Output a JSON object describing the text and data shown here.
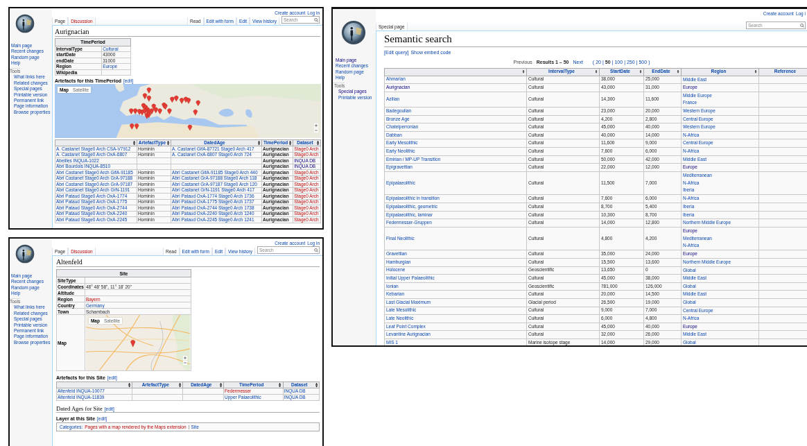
{
  "windows": [
    {
      "kind": "article",
      "title": "Aurignacian",
      "personal": [
        {
          "text": "Create account",
          "kind": "link"
        },
        {
          "text": "Log in",
          "kind": "link"
        }
      ],
      "left_tabs": [
        {
          "label": "Page",
          "selected": true,
          "kind": "plain"
        },
        {
          "label": "Discussion",
          "selected": false,
          "kind": "new"
        }
      ],
      "right_tabs": [
        {
          "label": "Read",
          "selected": true,
          "kind": "plain"
        },
        {
          "label": "Edit with form",
          "selected": false,
          "kind": "link"
        },
        {
          "label": "Edit",
          "selected": false,
          "kind": "link"
        },
        {
          "label": "View history",
          "selected": false,
          "kind": "link"
        }
      ],
      "search": {
        "placeholder": "Search"
      },
      "nav": [
        {
          "text": "Main page",
          "kind": "link"
        },
        {
          "text": "Recent changes",
          "kind": "link"
        },
        {
          "text": "Random page",
          "kind": "link"
        },
        {
          "text": "Help",
          "kind": "link"
        }
      ],
      "tools_heading": "Tools",
      "tools": [
        {
          "text": "What links here",
          "kind": "link"
        },
        {
          "text": "Related changes",
          "kind": "link"
        },
        {
          "text": "Special pages",
          "kind": "link"
        },
        {
          "text": "Printable version",
          "kind": "link"
        },
        {
          "text": "Permanent link",
          "kind": "link"
        },
        {
          "text": "Page information",
          "kind": "link"
        },
        {
          "text": "Browse properties",
          "kind": "link"
        }
      ],
      "infobox": {
        "heading": "TimePeriod",
        "rows": [
          {
            "label": "IntervalType",
            "value": {
              "text": "Cultural",
              "kind": "link"
            }
          },
          {
            "label": "startDate",
            "value": {
              "text": "43000",
              "kind": "plain"
            }
          },
          {
            "label": "endDate",
            "value": {
              "text": "31000",
              "kind": "plain"
            }
          },
          {
            "label": "Region",
            "value": {
              "text": "Europe",
              "kind": "link"
            }
          },
          {
            "label": "Wikipedia"
          }
        ]
      },
      "sections": [
        {
          "kind": "h3",
          "text": "Artefacts for this TimePeriod",
          "edit": "[edit]"
        },
        {
          "kind": "map",
          "controls": [
            {
              "label": "Map",
              "selected": true
            },
            {
              "label": "Satellite",
              "selected": false
            }
          ]
        },
        {
          "kind": "table",
          "columns": [
            {},
            {
              "label": "ArtefactType"
            },
            {
              "label": "DatedAge"
            },
            {
              "label": "TimePeriod"
            },
            {
              "label": "Dataset"
            }
          ],
          "rows": [
            [
              {
                "text": "A. Castanet Stage0 Arch CSA-V7912",
                "kind": "link"
              },
              {
                "text": "Hominin",
                "kind": "plain"
              },
              {
                "text": "A. Castanet GifA-87721 Stage0 Arch 417",
                "kind": "link"
              },
              {
                "text": "Aurignacian",
                "kind": "strong"
              },
              {
                "text": "Stage0 Arch",
                "kind": "new"
              }
            ],
            [
              {
                "text": "A. Castanet Stage0 Arch OxA-6807",
                "kind": "link"
              },
              {
                "text": "Hominin",
                "kind": "plain"
              },
              {
                "text": "A. Castanet OxA-6807 Stage0 Arch 724",
                "kind": "link"
              },
              {
                "text": "Aurignacian",
                "kind": "strong"
              },
              {
                "text": "Stage0 Arch",
                "kind": "new"
              }
            ],
            [
              {
                "text": "Abeilles INQUA-1022",
                "kind": "link"
              },
              null,
              null,
              {
                "text": "Aurignacian",
                "kind": "strong"
              },
              {
                "text": "INQUA DB",
                "kind": "visited"
              }
            ],
            [
              {
                "text": "Abri Bourdois INQUA-8510",
                "kind": "link"
              },
              null,
              null,
              {
                "text": "Aurignacian",
                "kind": "strong"
              },
              {
                "text": "INQUA DB",
                "kind": "visited"
              }
            ],
            [
              {
                "text": "Abri Castanet Stage0 Arch GifA-91185",
                "kind": "link"
              },
              {
                "text": "Hominin",
                "kind": "plain"
              },
              {
                "text": "Abri Castanet GifA-91185 Stage0 Arch 440",
                "kind": "link"
              },
              {
                "text": "Aurignacian",
                "kind": "strong"
              },
              {
                "text": "Stage0 Arch",
                "kind": "new"
              }
            ],
            [
              {
                "text": "Abri Castanet Stage0 Arch GrA-97188",
                "kind": "link"
              },
              {
                "text": "Hominin",
                "kind": "plain"
              },
              {
                "text": "Abri Castanet GrA-97188 Stage0 Arch 118",
                "kind": "link"
              },
              {
                "text": "Aurignacian",
                "kind": "strong"
              },
              {
                "text": "Stage0 Arch",
                "kind": "new"
              }
            ],
            [
              {
                "text": "Abri Castanet Stage0 Arch GrA-97187",
                "kind": "link"
              },
              {
                "text": "Hominin",
                "kind": "plain"
              },
              {
                "text": "Abri Castanet GrA-97187 Stage0 Arch 120",
                "kind": "link"
              },
              {
                "text": "Aurignacian",
                "kind": "strong"
              },
              {
                "text": "Stage0 Arch",
                "kind": "new"
              }
            ],
            [
              {
                "text": "Abri Castanet Stage0 Arch GrN-1191",
                "kind": "link"
              },
              {
                "text": "Hominin",
                "kind": "plain"
              },
              {
                "text": "Abri Castanet GrN-1191 Stage0 Arch 417",
                "kind": "link"
              },
              {
                "text": "Aurignacian",
                "kind": "strong"
              },
              {
                "text": "Stage0 Arch",
                "kind": "new"
              }
            ],
            [
              {
                "text": "Abri Pataud Stage0 Arch OxA-1774",
                "kind": "link"
              },
              {
                "text": "Hominin",
                "kind": "plain"
              },
              {
                "text": "Abri Pataud OxA-1774 Stage0 Arch 1736",
                "kind": "link"
              },
              {
                "text": "Aurignacian",
                "kind": "strong"
              },
              {
                "text": "Stage0 Arch",
                "kind": "new"
              }
            ],
            [
              {
                "text": "Abri Pataud Stage0 Arch OxA-1775",
                "kind": "link"
              },
              {
                "text": "Hominin",
                "kind": "plain"
              },
              {
                "text": "Abri Pataud OxA-1775 Stage0 Arch 1737",
                "kind": "link"
              },
              {
                "text": "Aurignacian",
                "kind": "strong"
              },
              {
                "text": "Stage0 Arch",
                "kind": "new"
              }
            ],
            [
              {
                "text": "Abri Pataud Stage0 Arch OxA-2744",
                "kind": "link"
              },
              {
                "text": "Hominin",
                "kind": "plain"
              },
              {
                "text": "Abri Pataud OxA-2744 Stage0 Arch 1738",
                "kind": "link"
              },
              {
                "text": "Aurignacian",
                "kind": "strong"
              },
              {
                "text": "Stage0 Arch",
                "kind": "new"
              }
            ],
            [
              {
                "text": "Abri Pataud Stage0 Arch OxA-2240",
                "kind": "link"
              },
              {
                "text": "Hominin",
                "kind": "plain"
              },
              {
                "text": "Abri Pataud OxA-2240 Stage0 Arch 1240",
                "kind": "link"
              },
              {
                "text": "Aurignacian",
                "kind": "strong"
              },
              {
                "text": "Stage0 Arch",
                "kind": "new"
              }
            ],
            [
              {
                "text": "Abri Pataud Stage0 Arch OxA-2245",
                "kind": "link"
              },
              {
                "text": "Hominin",
                "kind": "plain"
              },
              {
                "text": "Abri Pataud OxA-2245 Stage0 Arch 1241",
                "kind": "link"
              },
              {
                "text": "Aurignacian",
                "kind": "strong"
              },
              {
                "text": "Stage0 Arch",
                "kind": "new"
              }
            ]
          ]
        }
      ]
    },
    {
      "kind": "article",
      "title": "Altenfeld",
      "personal": [
        {
          "text": "Create account",
          "kind": "link"
        },
        {
          "text": "Log in",
          "kind": "link"
        }
      ],
      "left_tabs": [
        {
          "label": "Page",
          "selected": true,
          "kind": "plain"
        },
        {
          "label": "Discussion",
          "selected": false,
          "kind": "new"
        }
      ],
      "right_tabs": [
        {
          "label": "Read",
          "selected": true,
          "kind": "plain"
        },
        {
          "label": "Edit with form",
          "selected": false,
          "kind": "link"
        },
        {
          "label": "Edit",
          "selected": false,
          "kind": "link"
        },
        {
          "label": "View history",
          "selected": false,
          "kind": "link"
        }
      ],
      "search": {
        "placeholder": "Search"
      },
      "nav": [
        {
          "text": "Main page",
          "kind": "link"
        },
        {
          "text": "Recent changes",
          "kind": "link"
        },
        {
          "text": "Random page",
          "kind": "link"
        },
        {
          "text": "Help",
          "kind": "link"
        }
      ],
      "tools_heading": "Tools",
      "tools": [
        {
          "text": "What links here",
          "kind": "link"
        },
        {
          "text": "Related changes",
          "kind": "link"
        },
        {
          "text": "Special pages",
          "kind": "link"
        },
        {
          "text": "Printable version",
          "kind": "link"
        },
        {
          "text": "Permanent link",
          "kind": "link"
        },
        {
          "text": "Page information",
          "kind": "link"
        },
        {
          "text": "Browse properties",
          "kind": "link"
        }
      ],
      "infobox": {
        "heading": "Site",
        "rows": [
          {
            "label": "SiteType"
          },
          {
            "label": "Coordinates",
            "value": {
              "text": "48° 48' 58\", 11° 18' 20\"",
              "kind": "plain"
            }
          },
          {
            "label": "Altitude"
          },
          {
            "label": "Region",
            "value": {
              "text": "Bayern",
              "kind": "new"
            }
          },
          {
            "label": "Country",
            "value": {
              "text": "Germany",
              "kind": "link"
            }
          },
          {
            "label": "Town",
            "value": {
              "text": "Schambach",
              "kind": "plain"
            }
          },
          {
            "label": "Map",
            "map": {
              "controls": [
                {
                  "label": "Map",
                  "selected": true
                },
                {
                  "label": "Satellite",
                  "selected": false
                }
              ]
            }
          }
        ]
      },
      "sections": [
        {
          "kind": "h3",
          "text": "Artefacts for this Site",
          "edit": "[edit]"
        },
        {
          "kind": "table",
          "columns": [
            {},
            {
              "label": "ArtefactType"
            },
            {
              "label": "DatedAge"
            },
            {
              "label": "TimePeriod"
            },
            {
              "label": "Dataset"
            }
          ],
          "rows": [
            [
              {
                "text": "Altenfeld INQUA-10077",
                "kind": "link"
              },
              null,
              null,
              {
                "text": "Federmesser",
                "kind": "new"
              },
              {
                "text": "INQUA DB",
                "kind": "link"
              }
            ],
            [
              {
                "text": "Altenfeld INQUA-11839",
                "kind": "link"
              },
              null,
              null,
              {
                "text": "Upper Palaeolithic",
                "kind": "link"
              },
              {
                "text": "INQUA DB",
                "kind": "link"
              }
            ]
          ]
        },
        {
          "kind": "h2",
          "text": "Dated Ages for Site",
          "edit": "[edit]"
        },
        {
          "kind": "h3",
          "text": "Layer at this Site",
          "edit": "[edit]"
        },
        {
          "kind": "categories",
          "label": "Categories:",
          "links": [
            {
              "text": "Pages with a map rendered by the Maps extension",
              "kind": "new"
            },
            {
              "text": "Site",
              "kind": "link"
            }
          ]
        }
      ]
    },
    {
      "kind": "search",
      "title": "Semantic search",
      "personal": [
        {
          "text": "Create account",
          "kind": "link"
        },
        {
          "text": "Log i",
          "kind": "link"
        }
      ],
      "left_tabs": [
        {
          "label": "Special page",
          "selected": true,
          "kind": "plain"
        }
      ],
      "search": {
        "placeholder": "Search"
      },
      "nav": [
        {
          "text": "Main page",
          "kind": "visited"
        },
        {
          "text": "Recent changes",
          "kind": "link"
        },
        {
          "text": "Random page",
          "kind": "link"
        },
        {
          "text": "Help",
          "kind": "link"
        }
      ],
      "tools_heading": "Tools",
      "tools": [
        {
          "text": "Special pages",
          "kind": "visited"
        },
        {
          "text": "Printable version",
          "kind": "link"
        }
      ],
      "actions": [
        {
          "text": "[Edit query]",
          "kind": "link"
        },
        {
          "text": "Show embed code",
          "kind": "link"
        }
      ],
      "pager": {
        "previous": "Previous",
        "results": "Results 1 – 50",
        "next": "Next",
        "open": "(",
        "close": ")",
        "separator": "|",
        "limits": [
          {
            "text": "20",
            "selected": false
          },
          {
            "text": "50",
            "selected": true
          },
          {
            "text": "100",
            "selected": false
          },
          {
            "text": "250",
            "selected": false
          },
          {
            "text": "500",
            "selected": false
          }
        ]
      },
      "table": {
        "columns": [
          {},
          {
            "label": "IntervalType"
          },
          {
            "label": "StartDate"
          },
          {
            "label": "EndDate"
          },
          {
            "label": "Region"
          },
          {
            "label": "Reference"
          }
        ],
        "rows": [
          {
            "name": {
              "text": "Ahmarian",
              "kind": "link"
            },
            "interval_type": "Cultural",
            "start": "38,000",
            "end": "25,000",
            "regions": [
              {
                "text": "Middle East",
                "kind": "link"
              }
            ]
          },
          {
            "name": {
              "text": "Aurignacian",
              "kind": "visited"
            },
            "interval_type": "Cultural",
            "start": "43,000",
            "end": "31,000",
            "regions": [
              {
                "text": "Europe",
                "kind": "visited"
              }
            ]
          },
          {
            "name": {
              "text": "Azilian",
              "kind": "link"
            },
            "interval_type": "Cultural",
            "start": "14,300",
            "end": "11,600",
            "regions": [
              {
                "text": "Middle Europe",
                "kind": "link"
              },
              {
                "text": "France",
                "kind": "link"
              }
            ]
          },
          {
            "name": {
              "text": "Badegoulian",
              "kind": "link"
            },
            "interval_type": "Cultural",
            "start": "23,000",
            "end": "20,000",
            "regions": [
              {
                "text": "Western Europe",
                "kind": "link"
              }
            ]
          },
          {
            "name": {
              "text": "Bronze Age",
              "kind": "link"
            },
            "interval_type": "Cultural",
            "start": "4,200",
            "end": "2,800",
            "regions": [
              {
                "text": "Central Europe",
                "kind": "link"
              }
            ]
          },
          {
            "name": {
              "text": "Chatelperronian",
              "kind": "link"
            },
            "interval_type": "Cultural",
            "start": "45,000",
            "end": "40,000",
            "regions": [
              {
                "text": "Western Europe",
                "kind": "link"
              }
            ]
          },
          {
            "name": {
              "text": "Dabban",
              "kind": "link"
            },
            "interval_type": "Cultural",
            "start": "40,000",
            "end": "14,000",
            "regions": [
              {
                "text": "N-Africa",
                "kind": "link"
              }
            ]
          },
          {
            "name": {
              "text": "Early Mesolithic",
              "kind": "link"
            },
            "interval_type": "Cultural",
            "start": "11,600",
            "end": "9,000",
            "regions": [
              {
                "text": "Central Europe",
                "kind": "link"
              }
            ]
          },
          {
            "name": {
              "text": "Early Neolithic",
              "kind": "link"
            },
            "interval_type": "Cultural",
            "start": "7,600",
            "end": "6,000",
            "regions": [
              {
                "text": "N-Africa",
                "kind": "link"
              }
            ]
          },
          {
            "name": {
              "text": "Emirian / MP-UP Transition",
              "kind": "link"
            },
            "interval_type": "Cultural",
            "start": "50,000",
            "end": "42,000",
            "regions": [
              {
                "text": "Middle East",
                "kind": "link"
              }
            ]
          },
          {
            "name": {
              "text": "Epigravettian",
              "kind": "link"
            },
            "interval_type": "Cultural",
            "start": "22,000",
            "end": "12,000",
            "regions": [
              {
                "text": "Europe",
                "kind": "visited"
              }
            ]
          },
          {
            "name": {
              "text": "Epipalaeolithic",
              "kind": "link"
            },
            "interval_type": "Cultural",
            "start": "11,500",
            "end": "7,000",
            "regions": [
              {
                "text": "Mediterranean",
                "kind": "link"
              },
              {
                "text": "N-Africa",
                "kind": "link"
              },
              {
                "text": "Iberia",
                "kind": "link"
              }
            ]
          },
          {
            "name": {
              "text": "Epipalaeolithic in transition",
              "kind": "link"
            },
            "interval_type": "Cultural",
            "start": "7,600",
            "end": "6,000",
            "regions": [
              {
                "text": "N-Africa",
                "kind": "link"
              }
            ]
          },
          {
            "name": {
              "text": "Epipalaeolithic, geometric",
              "kind": "link"
            },
            "interval_type": "Cultural",
            "start": "8,700",
            "end": "5,400",
            "regions": [
              {
                "text": "Iberia",
                "kind": "link"
              }
            ]
          },
          {
            "name": {
              "text": "Epipalaeolithic, laminar",
              "kind": "link"
            },
            "interval_type": "Cultural",
            "start": "10,300",
            "end": "8,700",
            "regions": [
              {
                "text": "Iberia",
                "kind": "link"
              }
            ]
          },
          {
            "name": {
              "text": "Federmesser-Gruppen",
              "kind": "link"
            },
            "interval_type": "Cultural",
            "start": "14,000",
            "end": "12,800",
            "regions": [
              {
                "text": "Northern Middle Europe",
                "kind": "link"
              }
            ]
          },
          {
            "name": {
              "text": "Final Neolithic",
              "kind": "link"
            },
            "interval_type": "Cultural",
            "start": "4,800",
            "end": "4,200",
            "regions": [
              {
                "text": "Europe",
                "kind": "visited"
              },
              {
                "text": "Mediterranean",
                "kind": "link"
              },
              {
                "text": "N-Africa",
                "kind": "link"
              }
            ]
          },
          {
            "name": {
              "text": "Gravettian",
              "kind": "link"
            },
            "interval_type": "Cultural",
            "start": "35,000",
            "end": "24,000",
            "regions": [
              {
                "text": "Europe",
                "kind": "visited"
              }
            ]
          },
          {
            "name": {
              "text": "Hamburgian",
              "kind": "link"
            },
            "interval_type": "Cultural",
            "start": "15,500",
            "end": "13,600",
            "regions": [
              {
                "text": "Northern Middle Europe",
                "kind": "link"
              }
            ]
          },
          {
            "name": {
              "text": "Holocene",
              "kind": "link"
            },
            "interval_type": "Geoscientific",
            "start": "13,650",
            "end": "0",
            "regions": [
              {
                "text": "Global",
                "kind": "link"
              }
            ]
          },
          {
            "name": {
              "text": "Initial Upper Palaeolithic",
              "kind": "link"
            },
            "interval_type": "Cultural",
            "start": "45,000",
            "end": "38,000",
            "regions": [
              {
                "text": "Middle East",
                "kind": "link"
              }
            ]
          },
          {
            "name": {
              "text": "Ionian",
              "kind": "link"
            },
            "interval_type": "Geoscientific",
            "start": "781,000",
            "end": "126,000",
            "regions": [
              {
                "text": "Global",
                "kind": "link"
              }
            ]
          },
          {
            "name": {
              "text": "Kebarian",
              "kind": "link"
            },
            "interval_type": "Cultural",
            "start": "20,000",
            "end": "14,500",
            "regions": [
              {
                "text": "Middle East",
                "kind": "link"
              }
            ]
          },
          {
            "name": {
              "text": "Last Glacial Maximum",
              "kind": "link"
            },
            "interval_type": "Glacial period",
            "start": "26,500",
            "end": "19,000",
            "regions": [
              {
                "text": "Global",
                "kind": "link"
              }
            ]
          },
          {
            "name": {
              "text": "Late Mesolithic",
              "kind": "link"
            },
            "interval_type": "Cultural",
            "start": "9,000",
            "end": "7,000",
            "regions": [
              {
                "text": "Central Europe",
                "kind": "link"
              }
            ]
          },
          {
            "name": {
              "text": "Late Neolithic",
              "kind": "link"
            },
            "interval_type": "Cultural",
            "start": "6,000",
            "end": "4,800",
            "regions": [
              {
                "text": "N-Africa",
                "kind": "link"
              }
            ]
          },
          {
            "name": {
              "text": "Leaf Point Complex",
              "kind": "link"
            },
            "interval_type": "Cultural",
            "start": "45,000",
            "end": "40,000",
            "regions": [
              {
                "text": "Europe",
                "kind": "visited"
              }
            ]
          },
          {
            "name": {
              "text": "Levantine Aurignacian",
              "kind": "link"
            },
            "interval_type": "Cultural",
            "start": "32,000",
            "end": "26,000",
            "regions": [
              {
                "text": "Middle East",
                "kind": "link"
              }
            ]
          },
          {
            "name": {
              "text": "MIS 1",
              "kind": "link"
            },
            "interval_type": "Marine isotope stage",
            "start": "14,000",
            "end": "29,000",
            "regions": [
              {
                "text": "Global",
                "kind": "link"
              }
            ]
          }
        ]
      }
    }
  ]
}
